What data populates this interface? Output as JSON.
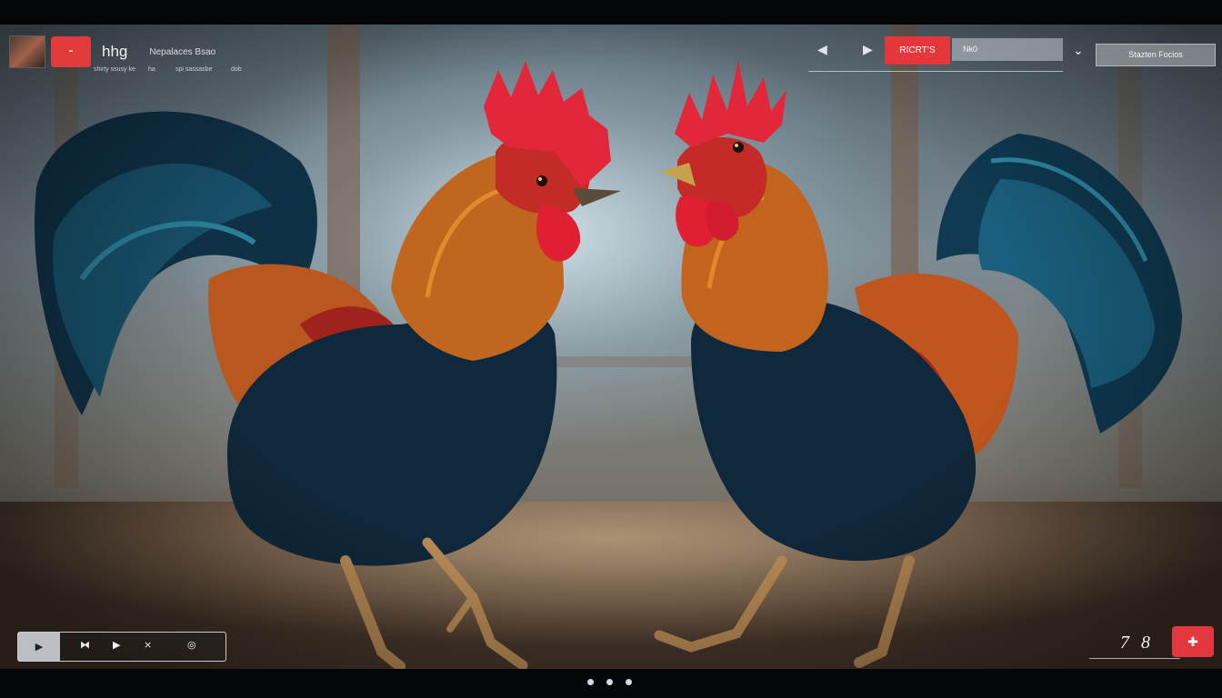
{
  "top_left": {
    "red_button_glyph": "⁃",
    "title": "hhg",
    "subtitle": "Nepalaces Bsao",
    "meta": [
      "shirty ssusy ke",
      "ha",
      "spi sassasbe",
      "dob"
    ]
  },
  "top_right": {
    "back_icon": "volume-icon",
    "back_glyph": "◀",
    "play_glyph": "▶",
    "record_label": "RICRT’S",
    "field_value": "Nk0",
    "chevron_glyph": "⌄",
    "dropdown_label": "Stazten Focios"
  },
  "transport": {
    "play_glyph": "▶",
    "buttons": [
      "⧓",
      "▶",
      "⨯",
      "◎"
    ]
  },
  "bottom_right": {
    "counter": "7 8",
    "button_glyph": "✚"
  },
  "pagination": {
    "count": 3
  },
  "colors": {
    "accent_red": "#e23b3b",
    "ui_text": "#e9edf2"
  }
}
